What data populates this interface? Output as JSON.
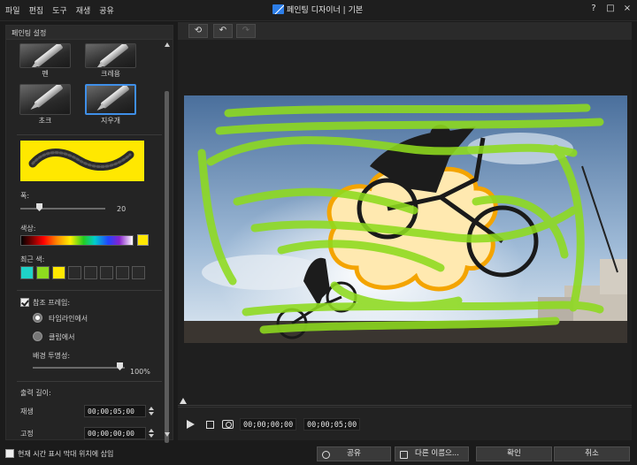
{
  "window": {
    "title": "페인팅 디자이너 | 기본",
    "menu": [
      "파일",
      "편집",
      "도구",
      "재생",
      "공유"
    ],
    "controls": [
      "?",
      "□",
      "×"
    ]
  },
  "panel": {
    "title": "페인팅 설정",
    "brushes": [
      {
        "label": "펜",
        "selected": false
      },
      {
        "label": "크레용",
        "selected": false
      },
      {
        "label": "초크",
        "selected": false
      },
      {
        "label": "지우개",
        "selected": true
      }
    ],
    "width": {
      "label": "폭:",
      "value": "20"
    },
    "color": {
      "label": "색상:",
      "current": "#ffe800"
    },
    "recent": {
      "label": "최근 색:",
      "colors": [
        "#1fd3c8",
        "#8edb1e",
        "#ffe800",
        "",
        "",
        "",
        "",
        "",
        ""
      ]
    },
    "reference": {
      "label": "참조 프레임:",
      "checked": true,
      "options": [
        {
          "label": "타임라인에서",
          "selected": true
        },
        {
          "label": "클립에서",
          "selected": false
        }
      ],
      "opacity_label": "배경 투명성:",
      "opacity_value": "100%"
    },
    "output": {
      "label": "출력 길이:",
      "play_label": "재생",
      "play_value": "00;00;05;00",
      "hold_label": "고정",
      "hold_value": "00;00;00;00"
    }
  },
  "toolbar": {
    "icons": [
      "rotate-icon",
      "undo-icon",
      "redo-icon"
    ]
  },
  "timeline": {
    "current": "00;00;00;00",
    "duration": "00;00;05;00"
  },
  "bottom": {
    "insert_label": "현재 시간 표시 막대 위치에 삽입",
    "share": "공유",
    "save_as": "다른 이름으...",
    "ok": "확인",
    "cancel": "취소"
  }
}
